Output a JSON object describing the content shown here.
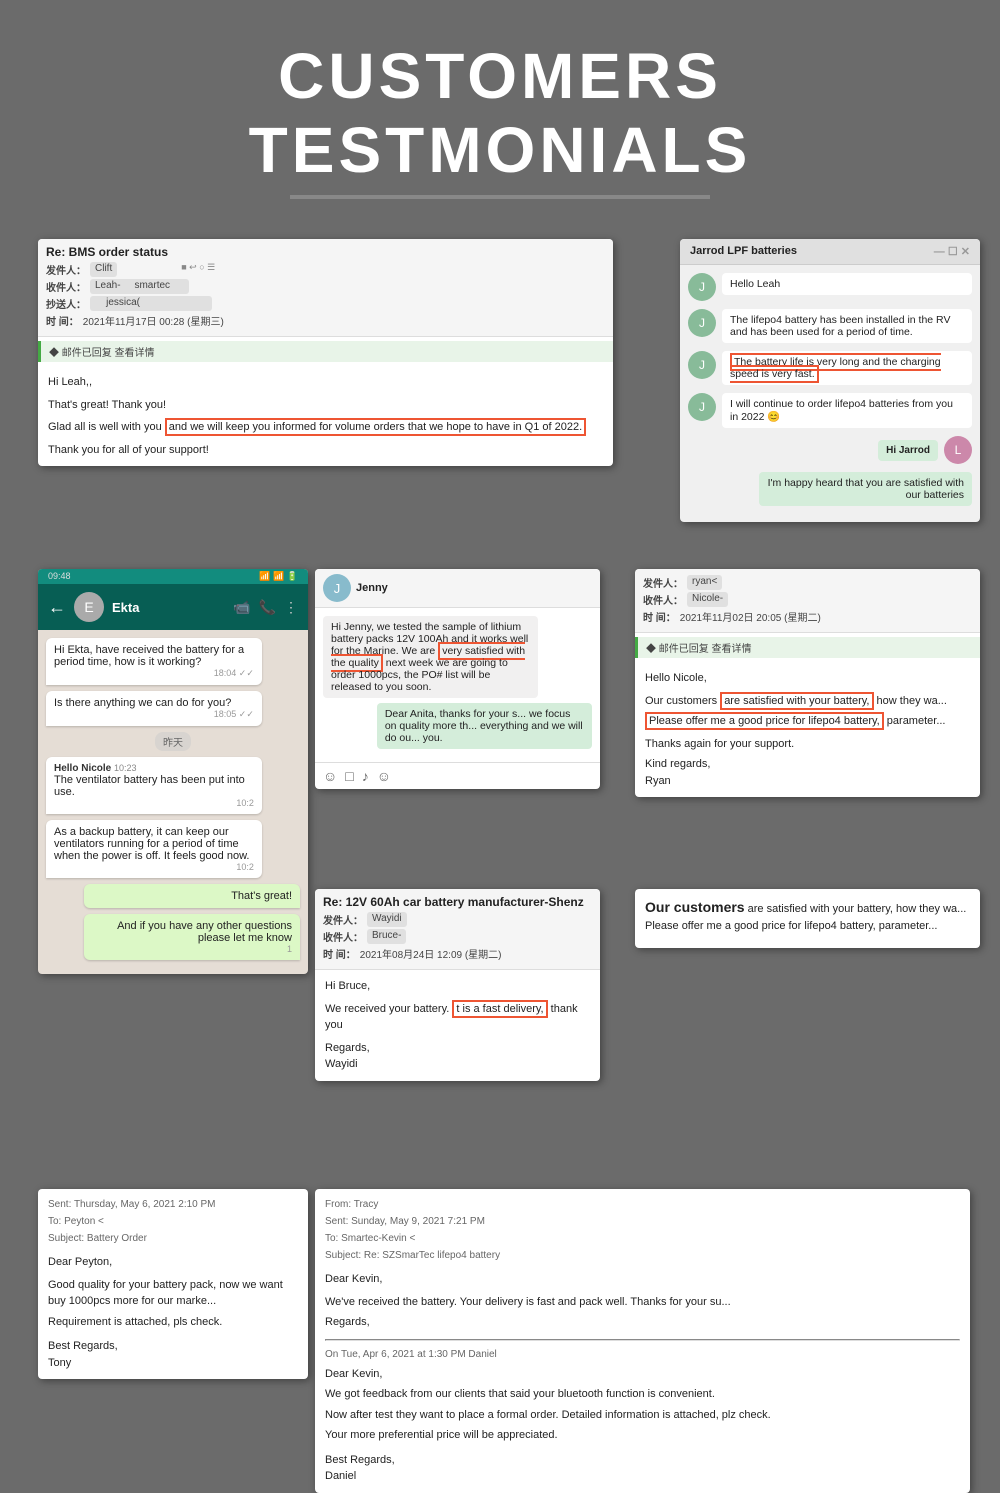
{
  "header": {
    "title_line1": "CUSTOMERS",
    "title_line2": "TESTMONIALS"
  },
  "email1": {
    "subject": "Re: BMS order status",
    "from_label": "发件人：",
    "from_val": "Clift",
    "to_label": "收件人：",
    "to_val": "Leah-          smartec",
    "cc_label": "抄送人：",
    "cc_val": "jessica(",
    "time_label": "时  间：",
    "time_val": "2021年11月17日 00:28 (星期三)",
    "replied": "◆ 邮件已回复  查看详情",
    "body_line1": "Hi Leah,,",
    "body_line2": "That's great! Thank you!",
    "body_line3": "Glad all is well with you",
    "body_highlight": "and we will keep you informed for volume orders that we hope to have in Q1 of 2022.",
    "body_line4": "Thank you for all of your support!"
  },
  "lfp_chat": {
    "header": "Jarrod          LPF batteries",
    "msg1": "Hello Leah",
    "msg2": "The lifepo4 battery has been installed in the RV and has been used for a period of time.",
    "msg3_highlight": "The battery life is very long and the charging speed is very fast.",
    "msg4": "I will continue to order lifepo4 batteries from you in 2022 😊",
    "reply_name": "Hi Jarrod",
    "reply_msg": "I'm happy heard that you are satisfied with our batteries"
  },
  "whatsapp1": {
    "status_bar": "09:48",
    "contact": "Ekta",
    "msg1": "Hi Ekta, have received the battery for a period time, how is it working?",
    "time1": "18:04 ✓✓",
    "msg2": "Is there anything we can do for you?",
    "time2": "18:05 ✓✓",
    "date_divider": "昨天",
    "msg3": "Hello Nicole    10:23",
    "msg4": "The ventilator battery has been put into use.",
    "time3": "10:2",
    "msg5": "As a backup battery, it can keep our ventilators running for a period of time when the power is off. It feels good now.",
    "time4": "10:2",
    "msg6_sent": "That's great!",
    "msg7_sent": "And if you have any other questions please let me know",
    "time5": "1"
  },
  "jenny_chat": {
    "header_text": "Hi Jenny,  we tested the sample of lithium battery packs 12V 100Ah and it works well for the Marine. We are",
    "highlight": "very satisfied with the quality",
    "body_cont": "next week we are going to order 1000pcs, the PO# list will be released to you soon.",
    "reply": "Dear Anita, thanks for your s... we focus on quality more th... everything and we will do ou... you.",
    "icons": "☺ □ ♪ ☺"
  },
  "email_wayidi": {
    "subject": "Re: 12V 60Ah car battery manufacturer-Shenz",
    "from_label": "发件人：",
    "from_val": "Wayidi",
    "to_label": "收件人：",
    "to_val": "Bruce-",
    "time_label": "时  间：",
    "time_val": "2021年08月24日 12:09 (星期二)",
    "body1": "Hi Bruce,",
    "body2": "We received your battery.",
    "highlight": "t is a fast delivery,",
    "body3": "thank you",
    "sign": "Regards,\nWayidi"
  },
  "email_ryan": {
    "from_label": "发件人：",
    "from_val": "ryan<",
    "to_label": "收件人：",
    "to_val": "Nicole-",
    "time_label": "时  间：",
    "time_val": "2021年11月02日 20:05 (星期二)",
    "replied": "◆ 邮件已回复  查看详情",
    "greeting": "Hello Nicole,",
    "body1_pre": "Our customers ",
    "body1_highlight": "are satisfied with your battery,",
    "body1_post": " how they wa...",
    "body2_pre": "Please offer me a good price for lifepo4 battery,",
    "body2_highlight": "parameter",
    "body3": "Thanks again for your support.",
    "sign": "Kind regards,\nRyan"
  },
  "email_bottom_left": {
    "sent": "Sent: Thursday, May 6, 2021 2:10 PM",
    "to": "To: Peyton <",
    "subject": "Subject: Battery Order",
    "greeting": "Dear Peyton,",
    "body1": "Good quality for your battery pack, now we want buy 1000pcs more for our marke...",
    "body2": "Requirement is attached, pls check.",
    "sign": "Best Regards,\nTony"
  },
  "email_bottom_right": {
    "from_label": "From: Tracy",
    "sent": "Sent: Sunday, May 9, 2021 7:21 PM",
    "to": "To: Smartec-Kevin <",
    "subject": "Subject: Re: SZSmarTec lifepo4 battery",
    "greeting": "Dear Kevin,",
    "body1": "We've received the battery. Your delivery is fast and pack well. Thanks for your su...",
    "sign": "Regards,",
    "sub_from": "On Tue, Apr 6, 2021 at 1:30 PM Daniel",
    "sub_greeting": "Dear Kevin,",
    "sub_body1": "We got feedback from our clients that said your bluetooth function is convenient.",
    "sub_body2": "Now after test they want to place a formal order. Detailed information is attached, plz check.",
    "sub_body3": "Your more preferential price will be appreciated.",
    "sub_sign": "Best Regards,\nDaniel"
  },
  "customers_text": "Our customers",
  "batteries_text": "that you are satisfied batteries",
  "satisfied_text": "very satisfied quality"
}
